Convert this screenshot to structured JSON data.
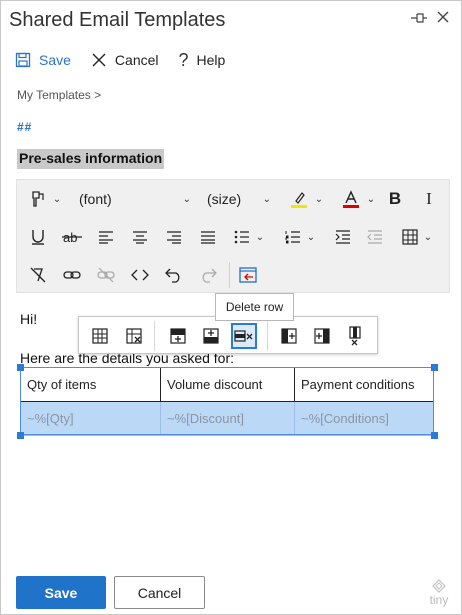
{
  "window": {
    "title": "Shared Email Templates"
  },
  "commands": {
    "save_label": "Save",
    "cancel_label": "Cancel",
    "help_label": "Help"
  },
  "breadcrumb": "My Templates >",
  "hash_text": "##",
  "template_title": "Pre-sales information",
  "editor_toolbar": {
    "font_label": "(font)",
    "size_label": "(size)",
    "bold": "B",
    "italic": "I"
  },
  "tooltip": "Delete row",
  "content": {
    "greeting": "Hi!",
    "intro": "Here are the details you asked for:"
  },
  "table": {
    "headers": [
      "Qty of items",
      "Volume discount",
      "Payment conditions"
    ],
    "selected_row": [
      "~%[Qty]",
      "~%[Discount]",
      "~%[Conditions]"
    ]
  },
  "footer": {
    "save_label": "Save",
    "cancel_label": "Cancel",
    "brand": "tiny"
  },
  "colors": {
    "accent": "#1f73c9",
    "selection": "#bcd8f7",
    "highlight_yellow": "#f2e600",
    "font_red": "#e00000"
  }
}
